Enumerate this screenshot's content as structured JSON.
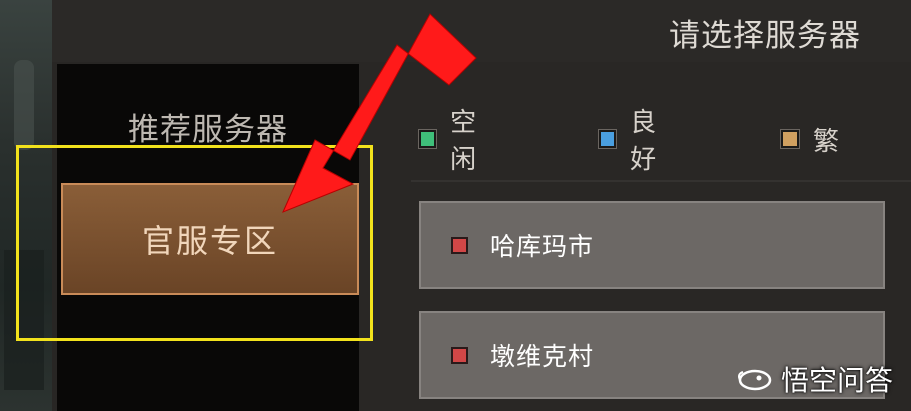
{
  "window": {
    "title": "请选择服务器"
  },
  "sidebar": {
    "heading": "推荐服务器",
    "selected_zone": "官服专区"
  },
  "legend": {
    "items": [
      {
        "label": "空闲",
        "color": "#3fbf7a"
      },
      {
        "label": "良好",
        "color": "#4a9fe0"
      },
      {
        "label": "繁",
        "color": "#d0a060"
      }
    ]
  },
  "servers": [
    {
      "name": "哈库玛市",
      "status_color": "#d24747"
    },
    {
      "name": "墩维克村",
      "status_color": "#d24747"
    }
  ],
  "annotations": {
    "highlight_color": "#f2e21c",
    "arrow_color": "#ff1a1a"
  },
  "watermark": {
    "text": "悟空问答",
    "logo": "bird-logo-icon"
  }
}
